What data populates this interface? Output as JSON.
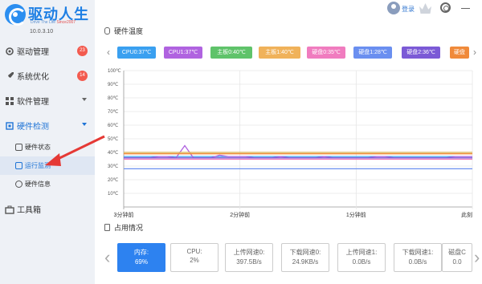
{
  "app": {
    "title": "驱动人生",
    "tagline_a": "Drive The Life",
    "tagline_b": "Since2007",
    "version": "10.0.3.10"
  },
  "sidebar": {
    "items": [
      {
        "label": "驱动管理",
        "badge": "23",
        "icon": "gear-icon"
      },
      {
        "label": "系统优化",
        "badge": "14",
        "icon": "rocket-icon"
      },
      {
        "label": "软件管理",
        "icon": "grid-icon"
      },
      {
        "label": "硬件检测",
        "icon": "chip-icon"
      }
    ],
    "subitems": [
      {
        "label": "硬件状态",
        "icon": "status-icon"
      },
      {
        "label": "运行监测",
        "icon": "monitor-icon"
      },
      {
        "label": "硬件信息",
        "icon": "info-icon"
      }
    ],
    "toolbox": "工具箱"
  },
  "topbar": {
    "login": "登录"
  },
  "temp_section": {
    "title": "硬件温度"
  },
  "legend": [
    {
      "label": "CPU0:37℃",
      "color": "#3aa0f0"
    },
    {
      "label": "CPU1:37℃",
      "color": "#b063e0"
    },
    {
      "label": "主板0:40℃",
      "color": "#5fc36a"
    },
    {
      "label": "主板1:40℃",
      "color": "#f0b25a"
    },
    {
      "label": "硬盘0:35℃",
      "color": "#f07cbf"
    },
    {
      "label": "硬盘1:28℃",
      "color": "#6a8ff0"
    },
    {
      "label": "硬盘2:36℃",
      "color": "#7b5ad6"
    },
    {
      "label": "硬盘",
      "color": "#f08a3a"
    }
  ],
  "chart_data": {
    "type": "line",
    "title": "硬件温度",
    "xlabel": "",
    "ylabel": "",
    "ylim": [
      0,
      100
    ],
    "yticks": [
      "100℃",
      "90℃",
      "80℃",
      "70℃",
      "60℃",
      "50℃",
      "40℃",
      "30℃",
      "20℃",
      "10℃"
    ],
    "xticks": [
      "3分钟前",
      "2分钟前",
      "1分钟前",
      "此刻"
    ],
    "grid": true,
    "series": [
      {
        "name": "CPU0:37℃",
        "color": "#3aa0f0",
        "values": [
          37,
          37,
          37,
          37,
          37,
          37,
          37,
          37,
          37,
          37,
          37,
          37,
          37,
          37,
          37,
          37,
          37,
          37,
          37,
          37,
          37,
          37,
          37,
          37,
          37,
          37,
          37,
          37,
          37,
          37,
          37,
          37,
          37,
          37,
          37,
          37,
          37,
          37,
          37,
          37,
          37
        ]
      },
      {
        "name": "CPU1:37℃",
        "color": "#b063e0",
        "values": [
          36,
          36,
          36,
          36,
          37,
          37,
          36,
          45,
          36,
          36,
          36,
          38,
          37,
          37,
          37,
          36,
          36,
          36,
          37,
          36,
          36,
          36,
          36,
          37,
          36,
          36,
          36,
          36,
          36,
          37,
          37,
          36,
          36,
          36,
          36,
          36,
          36,
          36,
          37,
          37,
          37
        ]
      },
      {
        "name": "主板0:40℃",
        "color": "#5fc36a",
        "values": [
          40,
          40,
          40,
          40,
          40,
          40,
          40,
          40,
          40,
          40,
          40,
          40,
          40,
          40,
          40,
          40,
          40,
          40,
          40,
          40,
          40,
          40,
          40,
          40,
          40,
          40,
          40,
          40,
          40,
          40,
          40,
          40,
          40,
          40,
          40,
          40,
          40,
          40,
          40,
          40,
          40
        ]
      },
      {
        "name": "主板1:40℃",
        "color": "#f0b25a",
        "values": [
          40,
          40,
          40,
          40,
          40,
          40,
          40,
          40,
          40,
          40,
          40,
          40,
          40,
          40,
          40,
          40,
          40,
          40,
          40,
          40,
          40,
          40,
          40,
          40,
          40,
          40,
          40,
          40,
          40,
          40,
          40,
          40,
          40,
          40,
          40,
          40,
          40,
          40,
          40,
          40,
          40
        ]
      },
      {
        "name": "硬盘0:35℃",
        "color": "#f07cbf",
        "values": [
          35,
          35,
          35,
          35,
          35,
          35,
          35,
          35,
          35,
          35,
          35,
          35,
          35,
          35,
          35,
          35,
          35,
          35,
          35,
          35,
          35,
          35,
          35,
          35,
          35,
          35,
          35,
          35,
          35,
          35,
          35,
          35,
          35,
          35,
          35,
          35,
          35,
          35,
          35,
          35,
          35
        ]
      },
      {
        "name": "硬盘1:28℃",
        "color": "#6a8ff0",
        "values": [
          28,
          28,
          28,
          28,
          28,
          28,
          28,
          28,
          28,
          28,
          28,
          28,
          28,
          28,
          28,
          28,
          28,
          28,
          28,
          28,
          28,
          28,
          28,
          28,
          28,
          28,
          28,
          28,
          28,
          28,
          28,
          28,
          28,
          28,
          28,
          28,
          28,
          28,
          28,
          28,
          28
        ]
      },
      {
        "name": "硬盘2:36℃",
        "color": "#7b5ad6",
        "values": [
          36,
          36,
          36,
          36,
          36,
          36,
          36,
          36,
          36,
          36,
          36,
          36,
          36,
          36,
          36,
          36,
          36,
          36,
          36,
          36,
          36,
          36,
          36,
          36,
          36,
          36,
          36,
          36,
          36,
          36,
          36,
          36,
          36,
          36,
          36,
          36,
          36,
          36,
          36,
          36,
          36
        ]
      },
      {
        "name": "硬盘",
        "color": "#f08a3a",
        "values": [
          39,
          39,
          39,
          39,
          39,
          39,
          39,
          39,
          39,
          39,
          39,
          39,
          39,
          39,
          39,
          39,
          39,
          39,
          39,
          39,
          39,
          39,
          39,
          39,
          39,
          39,
          39,
          39,
          39,
          39,
          39,
          39,
          39,
          39,
          39,
          39,
          39,
          39,
          39,
          39,
          39
        ]
      }
    ]
  },
  "usage_section": {
    "title": "占用情况"
  },
  "cards": [
    {
      "label": "内存:",
      "value": "69%",
      "active": true
    },
    {
      "label": "CPU:",
      "value": "2%"
    },
    {
      "label": "上传网速0:",
      "value": "397.5B/s"
    },
    {
      "label": "下载网速0:",
      "value": "24.9KB/s"
    },
    {
      "label": "上传网速1:",
      "value": "0.0B/s"
    },
    {
      "label": "下载网速1:",
      "value": "0.0B/s"
    },
    {
      "label": "磁盘C",
      "value": "0.0"
    }
  ],
  "colors": {
    "accent": "#2d82f0",
    "annotation": "#e53935"
  }
}
